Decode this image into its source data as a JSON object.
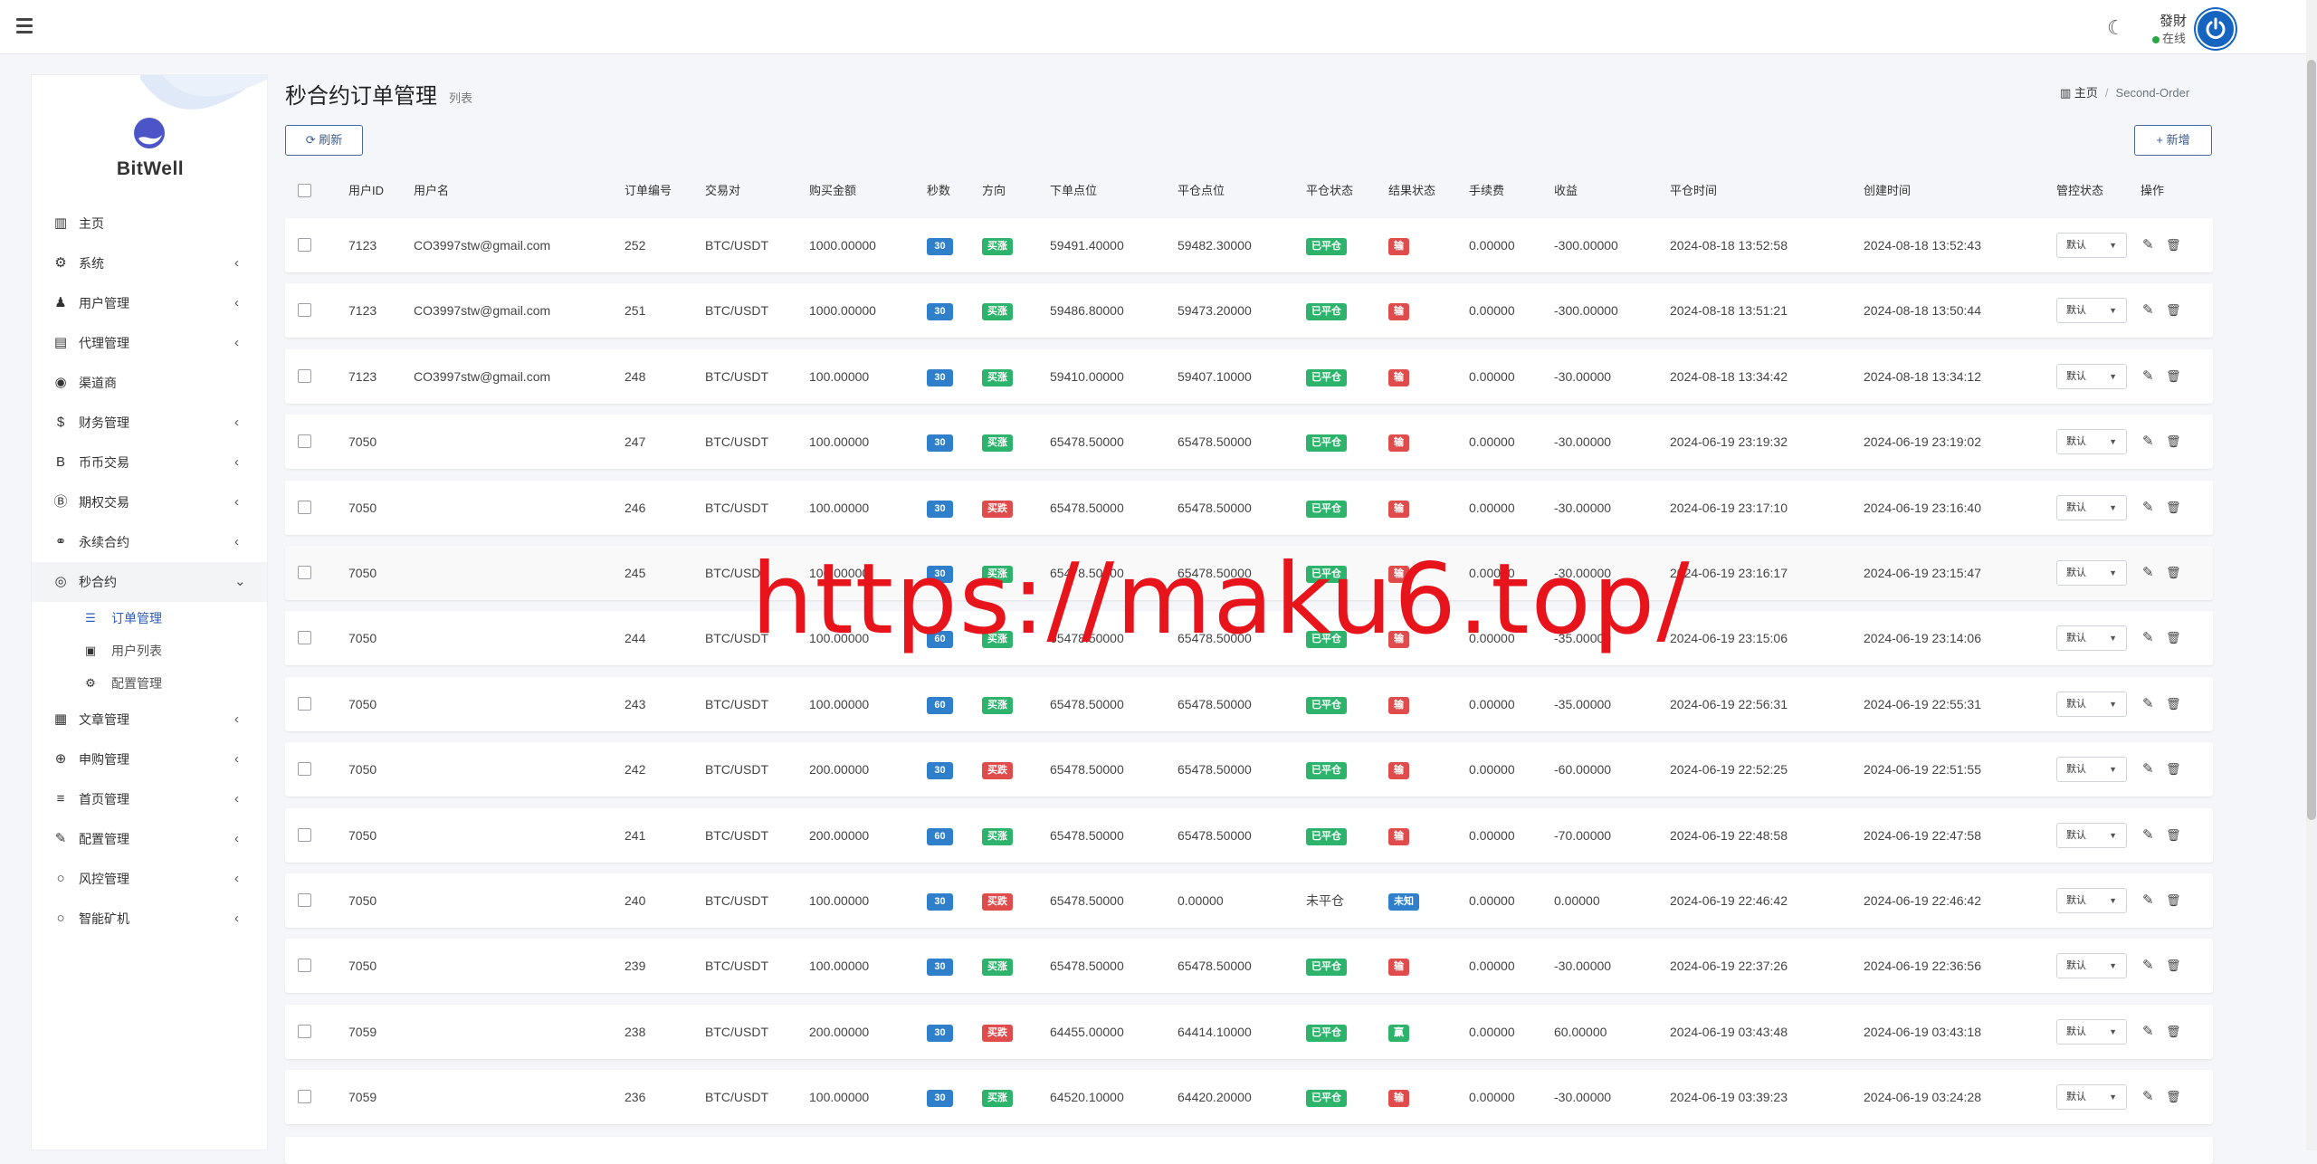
{
  "header": {
    "user_name": "發財",
    "user_status": "在线",
    "theme_icon": "moon-icon"
  },
  "sidebar": {
    "logo_text": "BitWell",
    "items": [
      {
        "label": "主页",
        "icon": "dashboard-icon",
        "glyph": "▥",
        "chev": ""
      },
      {
        "label": "系统",
        "icon": "gear-icon",
        "glyph": "⚙",
        "chev": "‹"
      },
      {
        "label": "用户管理",
        "icon": "user-icon",
        "glyph": "♟",
        "chev": "‹"
      },
      {
        "label": "代理管理",
        "icon": "id-card-icon",
        "glyph": "▤",
        "chev": "‹"
      },
      {
        "label": "渠道商",
        "icon": "user-circle-icon",
        "glyph": "◉",
        "chev": ""
      },
      {
        "label": "财务管理",
        "icon": "dollar-icon",
        "glyph": "$",
        "chev": "‹"
      },
      {
        "label": "币币交易",
        "icon": "bitcoin-icon",
        "glyph": "B",
        "chev": "‹"
      },
      {
        "label": "期权交易",
        "icon": "bitcoin-circle-icon",
        "glyph": "Ⓑ",
        "chev": "‹"
      },
      {
        "label": "永续合约",
        "icon": "link-icon",
        "glyph": "⚭",
        "chev": "‹"
      },
      {
        "label": "秒合约",
        "icon": "target-icon",
        "glyph": "◎",
        "chev": "⌄"
      }
    ],
    "sub_items": [
      {
        "label": "订单管理",
        "icon": "list-icon",
        "glyph": "☰"
      },
      {
        "label": "用户列表",
        "icon": "address-book-icon",
        "glyph": "▣"
      },
      {
        "label": "配置管理",
        "icon": "cog-icon",
        "glyph": "⚙"
      }
    ],
    "items_after": [
      {
        "label": "文章管理",
        "icon": "newspaper-icon",
        "glyph": "▦",
        "chev": "‹"
      },
      {
        "label": "申购管理",
        "icon": "life-ring-icon",
        "glyph": "⊕",
        "chev": "‹"
      },
      {
        "label": "首页管理",
        "icon": "bars-icon",
        "glyph": "≡",
        "chev": "‹"
      },
      {
        "label": "配置管理",
        "icon": "wrench-icon",
        "glyph": "✎",
        "chev": "‹"
      },
      {
        "label": "风控管理",
        "icon": "circle-icon",
        "glyph": "○",
        "chev": "‹"
      },
      {
        "label": "智能矿机",
        "icon": "circle-icon",
        "glyph": "○",
        "chev": "‹"
      }
    ]
  },
  "page": {
    "title": "秒合约订单管理",
    "subtitle": "列表",
    "breadcrumb_home": "主页",
    "breadcrumb_sep": "/",
    "breadcrumb_current": "Second-Order",
    "refresh_label": "刷新",
    "add_label": "新增"
  },
  "table": {
    "headers": [
      "用户ID",
      "用户名",
      "订单编号",
      "交易对",
      "购买金额",
      "秒数",
      "方向",
      "下单点位",
      "平仓点位",
      "平仓状态",
      "结果状态",
      "手续费",
      "收益",
      "平仓时间",
      "创建时间",
      "管控状态",
      "操作"
    ],
    "select_default": "默认",
    "rows": [
      {
        "uid": "7123",
        "username": "CO3997stw@gmail.com",
        "order_no": "252",
        "pair": "BTC/USDT",
        "amount": "1000.00000",
        "seconds": "30",
        "direction": "买涨",
        "dir_type": "up",
        "open_price": "59491.40000",
        "close_price": "59482.30000",
        "close_status": "已平仓",
        "close_badge": true,
        "result": "输",
        "result_type": "lose",
        "fee": "0.00000",
        "profit": "-300.00000",
        "close_time": "2024-08-18 13:52:58",
        "create_time": "2024-08-18 13:52:43"
      },
      {
        "uid": "7123",
        "username": "CO3997stw@gmail.com",
        "order_no": "251",
        "pair": "BTC/USDT",
        "amount": "1000.00000",
        "seconds": "30",
        "direction": "买涨",
        "dir_type": "up",
        "open_price": "59486.80000",
        "close_price": "59473.20000",
        "close_status": "已平仓",
        "close_badge": true,
        "result": "输",
        "result_type": "lose",
        "fee": "0.00000",
        "profit": "-300.00000",
        "close_time": "2024-08-18 13:51:21",
        "create_time": "2024-08-18 13:50:44"
      },
      {
        "uid": "7123",
        "username": "CO3997stw@gmail.com",
        "order_no": "248",
        "pair": "BTC/USDT",
        "amount": "100.00000",
        "seconds": "30",
        "direction": "买涨",
        "dir_type": "up",
        "open_price": "59410.00000",
        "close_price": "59407.10000",
        "close_status": "已平仓",
        "close_badge": true,
        "result": "输",
        "result_type": "lose",
        "fee": "0.00000",
        "profit": "-30.00000",
        "close_time": "2024-08-18 13:34:42",
        "create_time": "2024-08-18 13:34:12"
      },
      {
        "uid": "7050",
        "username": "",
        "order_no": "247",
        "pair": "BTC/USDT",
        "amount": "100.00000",
        "seconds": "30",
        "direction": "买涨",
        "dir_type": "up",
        "open_price": "65478.50000",
        "close_price": "65478.50000",
        "close_status": "已平仓",
        "close_badge": true,
        "result": "输",
        "result_type": "lose",
        "fee": "0.00000",
        "profit": "-30.00000",
        "close_time": "2024-06-19 23:19:32",
        "create_time": "2024-06-19 23:19:02"
      },
      {
        "uid": "7050",
        "username": "",
        "order_no": "246",
        "pair": "BTC/USDT",
        "amount": "100.00000",
        "seconds": "30",
        "direction": "买跌",
        "dir_type": "down",
        "open_price": "65478.50000",
        "close_price": "65478.50000",
        "close_status": "已平仓",
        "close_badge": true,
        "result": "输",
        "result_type": "lose",
        "fee": "0.00000",
        "profit": "-30.00000",
        "close_time": "2024-06-19 23:17:10",
        "create_time": "2024-06-19 23:16:40"
      },
      {
        "uid": "7050",
        "username": "",
        "order_no": "245",
        "pair": "BTC/USDT",
        "amount": "100.00000",
        "seconds": "30",
        "direction": "买涨",
        "dir_type": "up",
        "open_price": "65478.50000",
        "close_price": "65478.50000",
        "close_status": "已平仓",
        "close_badge": true,
        "result": "输",
        "result_type": "lose",
        "fee": "0.00000",
        "profit": "-30.00000",
        "close_time": "2024-06-19 23:16:17",
        "create_time": "2024-06-19 23:15:47"
      },
      {
        "uid": "7050",
        "username": "",
        "order_no": "244",
        "pair": "BTC/USDT",
        "amount": "100.00000",
        "seconds": "60",
        "direction": "买涨",
        "dir_type": "up",
        "open_price": "65478.50000",
        "close_price": "65478.50000",
        "close_status": "已平仓",
        "close_badge": true,
        "result": "输",
        "result_type": "lose",
        "fee": "0.00000",
        "profit": "-35.00000",
        "close_time": "2024-06-19 23:15:06",
        "create_time": "2024-06-19 23:14:06"
      },
      {
        "uid": "7050",
        "username": "",
        "order_no": "243",
        "pair": "BTC/USDT",
        "amount": "100.00000",
        "seconds": "60",
        "direction": "买涨",
        "dir_type": "up",
        "open_price": "65478.50000",
        "close_price": "65478.50000",
        "close_status": "已平仓",
        "close_badge": true,
        "result": "输",
        "result_type": "lose",
        "fee": "0.00000",
        "profit": "-35.00000",
        "close_time": "2024-06-19 22:56:31",
        "create_time": "2024-06-19 22:55:31"
      },
      {
        "uid": "7050",
        "username": "",
        "order_no": "242",
        "pair": "BTC/USDT",
        "amount": "200.00000",
        "seconds": "30",
        "direction": "买跌",
        "dir_type": "down",
        "open_price": "65478.50000",
        "close_price": "65478.50000",
        "close_status": "已平仓",
        "close_badge": true,
        "result": "输",
        "result_type": "lose",
        "fee": "0.00000",
        "profit": "-60.00000",
        "close_time": "2024-06-19 22:52:25",
        "create_time": "2024-06-19 22:51:55"
      },
      {
        "uid": "7050",
        "username": "",
        "order_no": "241",
        "pair": "BTC/USDT",
        "amount": "200.00000",
        "seconds": "60",
        "direction": "买涨",
        "dir_type": "up",
        "open_price": "65478.50000",
        "close_price": "65478.50000",
        "close_status": "已平仓",
        "close_badge": true,
        "result": "输",
        "result_type": "lose",
        "fee": "0.00000",
        "profit": "-70.00000",
        "close_time": "2024-06-19 22:48:58",
        "create_time": "2024-06-19 22:47:58"
      },
      {
        "uid": "7050",
        "username": "",
        "order_no": "240",
        "pair": "BTC/USDT",
        "amount": "100.00000",
        "seconds": "30",
        "direction": "买跌",
        "dir_type": "down",
        "open_price": "65478.50000",
        "close_price": "0.00000",
        "close_status": "未平仓",
        "close_badge": false,
        "result": "未知",
        "result_type": "unknown",
        "fee": "0.00000",
        "profit": "0.00000",
        "close_time": "2024-06-19 22:46:42",
        "create_time": "2024-06-19 22:46:42"
      },
      {
        "uid": "7050",
        "username": "",
        "order_no": "239",
        "pair": "BTC/USDT",
        "amount": "100.00000",
        "seconds": "30",
        "direction": "买涨",
        "dir_type": "up",
        "open_price": "65478.50000",
        "close_price": "65478.50000",
        "close_status": "已平仓",
        "close_badge": true,
        "result": "输",
        "result_type": "lose",
        "fee": "0.00000",
        "profit": "-30.00000",
        "close_time": "2024-06-19 22:37:26",
        "create_time": "2024-06-19 22:36:56"
      },
      {
        "uid": "7059",
        "username": "",
        "order_no": "238",
        "pair": "BTC/USDT",
        "amount": "200.00000",
        "seconds": "30",
        "direction": "买跌",
        "dir_type": "down",
        "open_price": "64455.00000",
        "close_price": "64414.10000",
        "close_status": "已平仓",
        "close_badge": true,
        "result": "赢",
        "result_type": "win",
        "fee": "0.00000",
        "profit": "60.00000",
        "close_time": "2024-06-19 03:43:48",
        "create_time": "2024-06-19 03:43:18"
      },
      {
        "uid": "7059",
        "username": "",
        "order_no": "236",
        "pair": "BTC/USDT",
        "amount": "100.00000",
        "seconds": "30",
        "direction": "买涨",
        "dir_type": "up",
        "open_price": "64520.10000",
        "close_price": "64420.20000",
        "close_status": "已平仓",
        "close_badge": true,
        "result": "输",
        "result_type": "lose",
        "fee": "0.00000",
        "profit": "-30.00000",
        "close_time": "2024-06-19 03:39:23",
        "create_time": "2024-06-19 03:24:28"
      }
    ]
  },
  "watermark": "https://maku6.top/",
  "colors": {
    "accent": "#2c5bb8",
    "badge_blue": "#2f7fca",
    "badge_green": "#2db36b",
    "badge_red": "#e04b4b",
    "watermark": "#e8141b"
  }
}
